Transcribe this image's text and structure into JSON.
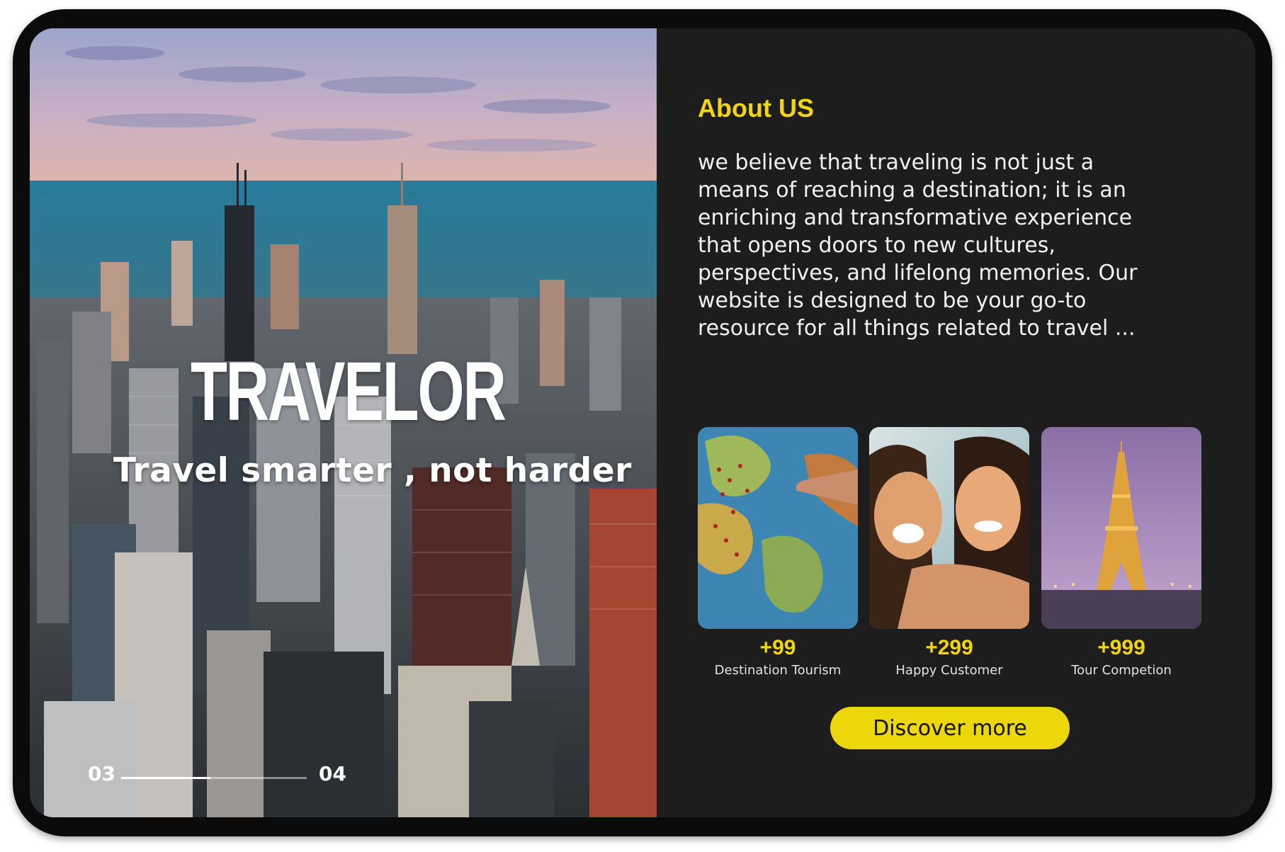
{
  "hero": {
    "title": "TRAVELOR",
    "tagline": "Travel smarter , not harder",
    "slider": {
      "current": "03",
      "next": "04",
      "progress": 0.48
    }
  },
  "about": {
    "title": "About US",
    "text": "we believe that traveling is not just a means of reaching a destination; it is an enriching and transformative experience that opens doors to new cultures, perspectives, and lifelong memories. Our website is designed to be your go-to resource for all things related to travel ..."
  },
  "stats": [
    {
      "value": "+99",
      "label": "Destination Tourism",
      "image": "world-map-photo"
    },
    {
      "value": "+299",
      "label": "Happy Customer",
      "image": "smiling-friends-photo"
    },
    {
      "value": "+999",
      "label": "Tour Competion",
      "image": "eiffel-tower-photo"
    }
  ],
  "cta": {
    "label": "Discover more"
  },
  "colors": {
    "accent": "#f2d417",
    "panel": "#1d1d1d",
    "button": "#ecd70b"
  }
}
